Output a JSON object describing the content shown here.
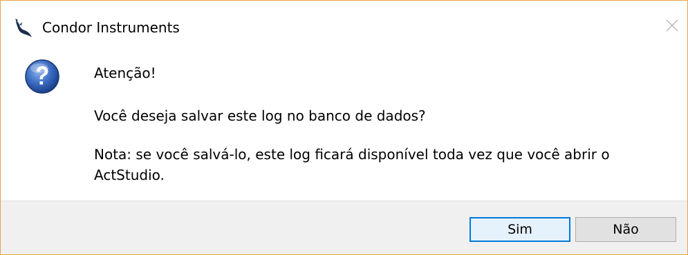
{
  "window": {
    "title": "Condor Instruments",
    "app_icon": "condor-bird-icon",
    "close_icon": "close-icon",
    "border_color": "#e8a14a"
  },
  "message": {
    "icon": "question-icon",
    "heading": "Atenção!",
    "question": "Você deseja salvar este log no banco de dados?",
    "note": "Nota: se você salvá-lo, este log ficará disponível toda vez que você abrir o ActStudio."
  },
  "buttons": {
    "yes_label": "Sim",
    "no_label": "Não",
    "focused": "Sim",
    "focus_color": "#0078d7"
  }
}
